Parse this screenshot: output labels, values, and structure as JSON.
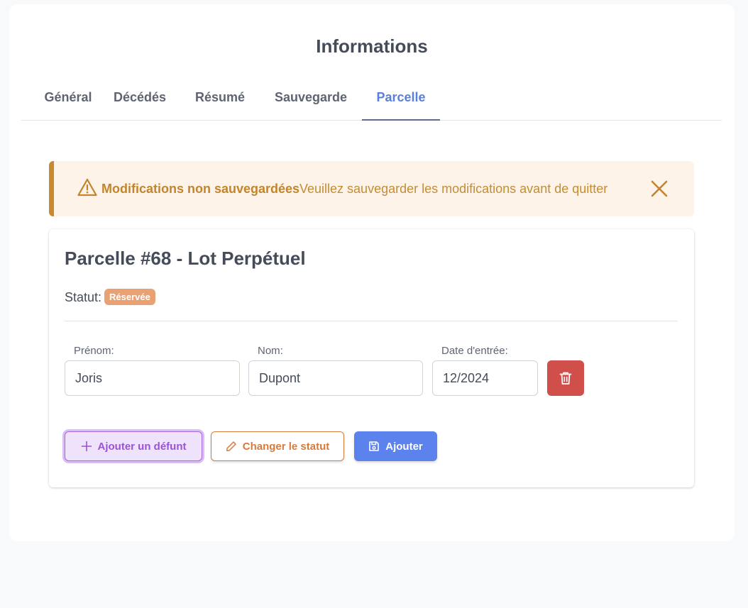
{
  "page": {
    "title": "Informations"
  },
  "tabs": [
    {
      "label": "Général"
    },
    {
      "label": "Décédés"
    },
    {
      "label": "Résumé"
    },
    {
      "label": "Sauvegarde"
    },
    {
      "label": "Parcelle",
      "active": true
    }
  ],
  "alert": {
    "title": "Modifications non sauvegardées",
    "message": "Veuillez sauvegarder les modifications avant de quitter",
    "icon": "warning-triangle-icon",
    "close_icon": "close-icon"
  },
  "parcel": {
    "title": "Parcelle #68 - Lot Perpétuel",
    "status_label": "Statut:",
    "status_badge": "Réservée",
    "fields": {
      "first_name_label": "Prénom:",
      "first_name_value": "Joris",
      "last_name_label": "Nom:",
      "last_name_value": "Dupont",
      "entry_date_label": "Date d'entrée:",
      "entry_date_value": "12/2024"
    },
    "buttons": {
      "add_deceased": "Ajouter un défunt",
      "change_status": "Changer le statut",
      "add": "Ajouter"
    }
  },
  "colors": {
    "accent": "#5b7fdc",
    "warning": "#c9892f",
    "danger": "#d04f4a",
    "status_badge": "#e9a072",
    "purple": "#9b53d6",
    "orange": "#d87a3a",
    "primary": "#5c82ee"
  }
}
